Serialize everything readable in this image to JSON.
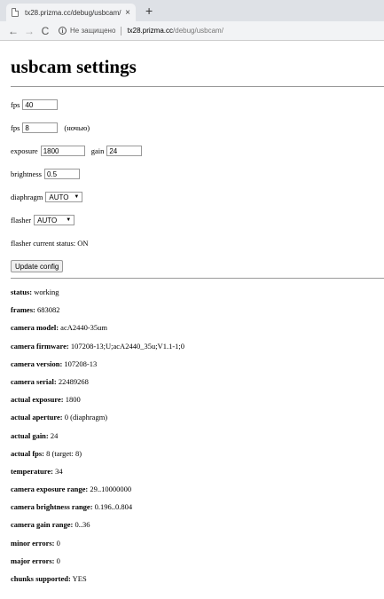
{
  "browser": {
    "tab_title": "tx28.prizma.cc/debug/usbcam/",
    "tab_close": "×",
    "new_tab": "+",
    "back": "←",
    "forward": "→",
    "reload": "C",
    "security_text": "Не защищено",
    "url_host": "tx28.prizma.cc",
    "url_path": "/debug/usbcam/"
  },
  "page": {
    "title": "usbcam settings",
    "form": {
      "fps_label": "fps",
      "fps_value": "40",
      "fps_night_label": "fps",
      "fps_night_value": "8",
      "fps_night_suffix": "(ночью)",
      "exposure_label": "exposure",
      "exposure_value": "1800",
      "gain_label": "gain",
      "gain_value": "24",
      "brightness_label": "brightness",
      "brightness_value": "0.5",
      "diaphragm_label": "diaphragm",
      "diaphragm_value": "AUTO",
      "flasher_label": "flasher",
      "flasher_value": "AUTO",
      "flasher_status_label": "flasher current status:",
      "flasher_status_value": "ON",
      "update_button": "Update config"
    },
    "status": [
      {
        "label": "status:",
        "value": "working"
      },
      {
        "label": "frames:",
        "value": "683082"
      },
      {
        "label": "camera model:",
        "value": "acA2440-35um"
      },
      {
        "label": "camera firmware:",
        "value": "107208-13;U;acA2440_35u;V1.1-1;0"
      },
      {
        "label": "camera version:",
        "value": "107208-13"
      },
      {
        "label": "camera serial:",
        "value": "22489268"
      },
      {
        "label": "actual exposure:",
        "value": "1800"
      },
      {
        "label": "actual aperture:",
        "value": "0 (diaphragm)"
      },
      {
        "label": "actual gain:",
        "value": "24"
      },
      {
        "label": "actual fps:",
        "value": "8 (target: 8)"
      },
      {
        "label": "temperature:",
        "value": "34"
      },
      {
        "label": "camera exposure range:",
        "value": "29..10000000"
      },
      {
        "label": "camera brightness range:",
        "value": "0.196..0.804"
      },
      {
        "label": "camera gain range:",
        "value": "0..36"
      },
      {
        "label": "minor errors:",
        "value": "0"
      },
      {
        "label": "major errors:",
        "value": "0"
      },
      {
        "label": "chunks supported:",
        "value": "YES"
      }
    ]
  }
}
